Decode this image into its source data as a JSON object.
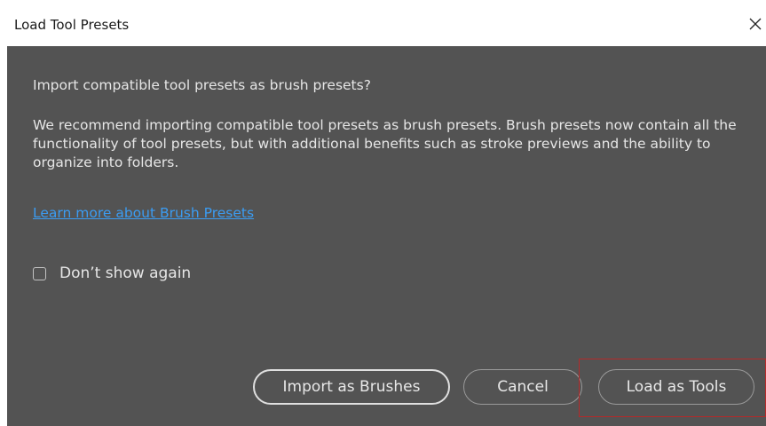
{
  "window": {
    "title": "Load Tool Presets"
  },
  "dialog": {
    "heading": "Import compatible tool presets as brush presets?",
    "description": "We recommend importing compatible tool presets as brush presets. Brush presets now contain all the functionality of tool presets, but with additional benefits such as stroke previews and the ability to organize into folders.",
    "link": "Learn more about Brush Presets",
    "checkbox_label": "Don’t show again",
    "checkbox_checked": false
  },
  "buttons": {
    "import": "Import as Brushes",
    "cancel": "Cancel",
    "load": "Load as Tools"
  },
  "colors": {
    "dialog_background": "#535353",
    "link": "#3b9cf2",
    "highlight_outline": "#b42a2a"
  },
  "icons": {
    "close": "close-icon"
  }
}
